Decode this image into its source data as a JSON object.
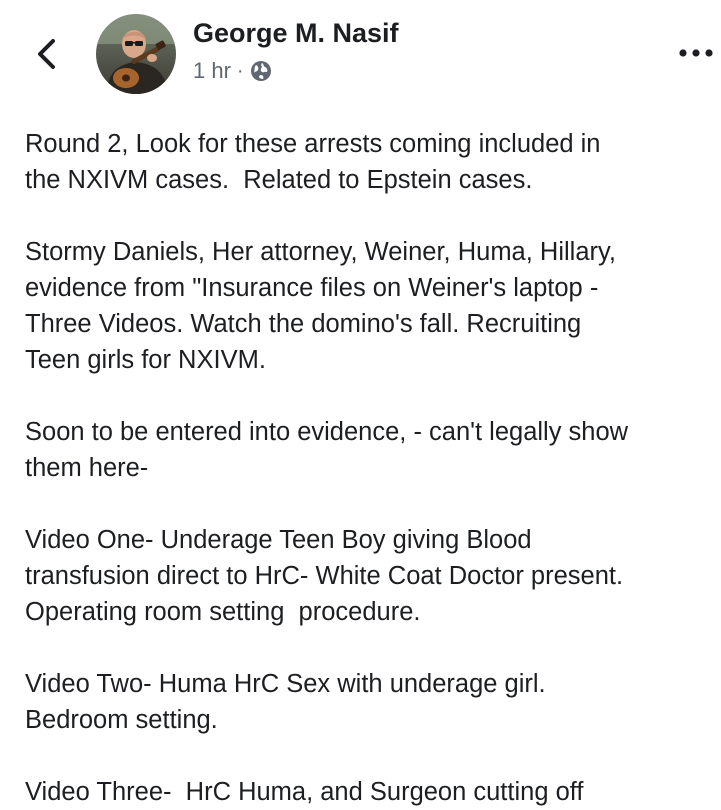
{
  "header": {
    "author_name": "George M. Nasif",
    "timestamp": "1 hr",
    "separator": "·",
    "audience_icon": "globe-icon",
    "back_icon": "chevron-left-icon",
    "more_icon": "more-horizontal-icon"
  },
  "post": {
    "paragraphs": [
      "Round 2, Look for these arrests coming included in\nthe NXIVM cases.  Related to Epstein cases.",
      "Stormy Daniels, Her attorney, Weiner, Huma, Hillary,\nevidence from \"Insurance files on Weiner's laptop -\nThree Videos. Watch the domino's fall. Recruiting\nTeen girls for NXIVM.",
      "Soon to be entered into evidence, - can't legally show\nthem here-",
      "Video One- Underage Teen Boy giving Blood\ntransfusion direct to HrC- White Coat Doctor present.\nOperating room setting  procedure.",
      "Video Two- Huma HrC Sex with underage girl.\nBedroom setting.",
      "Video Three-  HrC Huma, and Surgeon cutting off"
    ]
  },
  "colors": {
    "text": "#1c1e21",
    "meta_text": "#606770",
    "background": "#ffffff"
  }
}
